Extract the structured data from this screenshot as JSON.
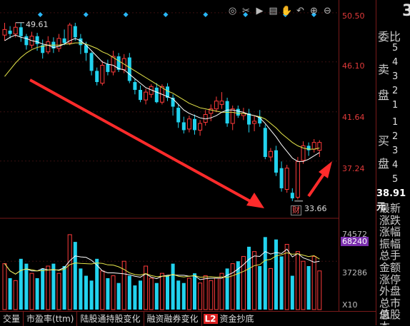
{
  "toolbar": {
    "icons": [
      "eye-icon",
      "scissors-icon",
      "play-icon",
      "document-icon",
      "hand-icon",
      "undo-icon",
      "zoom-in-icon",
      "zoom-out-icon"
    ],
    "glyphs": [
      "◎",
      "✂",
      "▶",
      "▤",
      "✋",
      "↶",
      "⊕",
      "⊖"
    ]
  },
  "price_axis": {
    "labels": [
      "50.50",
      "46.10",
      "41.64",
      "37.24"
    ]
  },
  "volume_axis": {
    "top": "74572",
    "highlight": "68240",
    "mid": "37286",
    "unit": "X10"
  },
  "annotations": {
    "high": "49.61",
    "low": "33.66",
    "low_tag": "财"
  },
  "side": {
    "big_char": "3",
    "title": "委比",
    "sell_label_1": "卖",
    "sell_label_2": "盘",
    "buy_label_1": "买",
    "buy_label_2": "盘",
    "sell_nums": [
      "5",
      "4",
      "3",
      "2",
      "1"
    ],
    "buy_nums": [
      "1",
      "2",
      "3",
      "4",
      "5"
    ],
    "price": "38.91元",
    "fields": [
      "最新",
      "涨跌",
      "涨幅",
      "振幅",
      "总手",
      "金额",
      "涨停",
      "外盘",
      "总市值",
      "总股本"
    ]
  },
  "tabs": [
    "交量",
    "市盈率(ttm)",
    "陆股通持股变化",
    "融资融券变化",
    "L2",
    "资金抄底"
  ],
  "colors": {
    "up": "#ff3b3b",
    "down": "#22d3ee",
    "ma_fast": "#ffffff",
    "ma_slow": "#e6e64a",
    "arrow": "#ff2b2b"
  },
  "chart_data": {
    "type": "candlestick",
    "candles": [
      [
        48.5,
        49.0,
        49.6,
        48.0
      ],
      [
        48.9,
        48.6,
        49.3,
        48.2
      ],
      [
        48.6,
        49.2,
        49.6,
        48.3
      ],
      [
        49.2,
        48.4,
        49.6,
        47.9
      ],
      [
        48.4,
        47.6,
        48.6,
        47.2
      ],
      [
        47.6,
        48.4,
        48.8,
        47.3
      ],
      [
        48.4,
        47.7,
        48.7,
        47.1
      ],
      [
        47.6,
        46.9,
        48.1,
        46.4
      ],
      [
        47.0,
        47.9,
        48.4,
        46.8
      ],
      [
        47.9,
        47.3,
        48.3,
        46.9
      ],
      [
        47.3,
        48.2,
        48.6,
        47.0
      ],
      [
        48.2,
        47.8,
        49.0,
        47.6
      ],
      [
        47.8,
        49.4,
        49.6,
        47.6
      ],
      [
        49.3,
        48.3,
        49.6,
        48.0
      ],
      [
        48.2,
        47.6,
        48.6,
        46.8
      ],
      [
        47.6,
        46.9,
        47.9,
        46.2
      ],
      [
        46.9,
        45.3,
        47.0,
        44.9
      ],
      [
        45.3,
        44.3,
        45.6,
        44.0
      ],
      [
        44.2,
        45.8,
        46.2,
        44.0
      ],
      [
        45.9,
        45.2,
        46.3,
        44.9
      ],
      [
        45.2,
        46.6,
        47.1,
        44.9
      ],
      [
        46.6,
        45.4,
        46.9,
        45.2
      ],
      [
        45.4,
        46.4,
        46.8,
        45.1
      ],
      [
        46.5,
        44.4,
        46.9,
        44.2
      ],
      [
        44.3,
        43.6,
        44.6,
        43.2
      ],
      [
        43.6,
        42.7,
        44.0,
        42.5
      ],
      [
        42.7,
        43.4,
        43.7,
        42.3
      ],
      [
        43.2,
        43.9,
        44.1,
        42.9
      ],
      [
        43.8,
        42.5,
        44.2,
        42.4
      ],
      [
        42.5,
        43.9,
        44.1,
        42.3
      ],
      [
        43.9,
        42.9,
        44.2,
        42.6
      ],
      [
        42.9,
        42.1,
        43.2,
        41.3
      ],
      [
        42.0,
        40.7,
        42.3,
        40.2
      ],
      [
        40.7,
        40.0,
        41.2,
        39.7
      ],
      [
        40.1,
        41.0,
        41.3,
        39.8
      ],
      [
        41.0,
        40.0,
        41.4,
        39.6
      ],
      [
        40.0,
        40.6,
        40.9,
        39.5
      ],
      [
        40.7,
        41.4,
        41.8,
        40.4
      ],
      [
        41.5,
        41.9,
        42.3,
        40.8
      ],
      [
        41.9,
        42.6,
        43.0,
        41.6
      ],
      [
        42.3,
        42.6,
        43.4,
        41.9
      ],
      [
        42.6,
        40.6,
        42.9,
        40.3
      ],
      [
        40.6,
        41.9,
        42.2,
        40.0
      ],
      [
        41.9,
        41.3,
        42.2,
        41.1
      ],
      [
        41.3,
        41.5,
        42.0,
        40.9
      ],
      [
        41.5,
        40.5,
        41.9,
        39.8
      ],
      [
        40.6,
        40.8,
        41.3,
        39.9
      ],
      [
        41.2,
        40.6,
        41.8,
        40.3
      ],
      [
        40.2,
        37.6,
        40.5,
        37.4
      ],
      [
        37.6,
        38.1,
        38.4,
        37.2
      ],
      [
        38.2,
        36.2,
        38.6,
        35.9
      ],
      [
        36.6,
        34.8,
        37.2,
        34.5
      ],
      [
        34.7,
        36.6,
        36.9,
        34.4
      ],
      [
        34.4,
        33.9,
        34.8,
        33.66
      ],
      [
        34.0,
        37.2,
        37.6,
        33.8
      ],
      [
        37.3,
        38.6,
        39.0,
        37.0
      ],
      [
        38.6,
        38.2,
        38.9,
        37.7
      ],
      [
        38.3,
        38.9,
        39.2,
        38.0
      ],
      [
        38.2,
        38.9,
        39.1,
        37.6
      ]
    ],
    "volumes": [
      19,
      13,
      12,
      21,
      19,
      15,
      13,
      17,
      18,
      19,
      15,
      18,
      31,
      28,
      17,
      14,
      12,
      21,
      16,
      13,
      14,
      11,
      20,
      14,
      10,
      12,
      18,
      13,
      11,
      15,
      14,
      19,
      12,
      11,
      13,
      15,
      11,
      14,
      12,
      13,
      15,
      17,
      19,
      20,
      22,
      26,
      24,
      18,
      30,
      17,
      29,
      22,
      27,
      14,
      24,
      20,
      18,
      22,
      16
    ],
    "ma_fast": [
      48.0,
      48.3,
      48.5,
      48.3,
      48.2,
      48.0,
      47.9,
      47.7,
      47.6,
      47.4,
      47.5,
      47.7,
      48.0,
      48.2,
      48.0,
      47.6,
      47.1,
      46.6,
      46.1,
      45.9,
      45.8,
      45.5,
      45.4,
      45.0,
      44.6,
      44.2,
      43.8,
      43.6,
      43.4,
      43.2,
      43.0,
      42.8,
      42.3,
      41.8,
      41.5,
      41.3,
      41.1,
      41.0,
      41.1,
      41.3,
      41.6,
      41.8,
      41.8,
      41.7,
      41.6,
      41.4,
      41.3,
      41.1,
      40.6,
      40.0,
      39.4,
      38.7,
      38.1,
      37.5,
      37.2,
      37.2,
      37.4,
      37.7,
      38.0
    ],
    "ma_slow": [
      44.8,
      45.4,
      46.0,
      46.5,
      46.9,
      47.2,
      47.4,
      47.5,
      47.6,
      47.6,
      47.6,
      47.7,
      47.7,
      47.8,
      47.8,
      47.7,
      47.5,
      47.3,
      47.0,
      46.8,
      46.5,
      46.2,
      45.9,
      45.6,
      45.3,
      45.0,
      44.7,
      44.4,
      44.1,
      43.8,
      43.5,
      43.3,
      43.0,
      42.7,
      42.4,
      42.2,
      42.0,
      41.9,
      41.8,
      41.7,
      41.6,
      41.6,
      41.6,
      41.5,
      41.5,
      41.4,
      41.3,
      41.2,
      41.0,
      40.6,
      40.2,
      39.7,
      39.3,
      38.9,
      38.6,
      38.4,
      38.3,
      38.3,
      38.4
    ],
    "ylim": [
      32.5,
      51.0
    ]
  }
}
